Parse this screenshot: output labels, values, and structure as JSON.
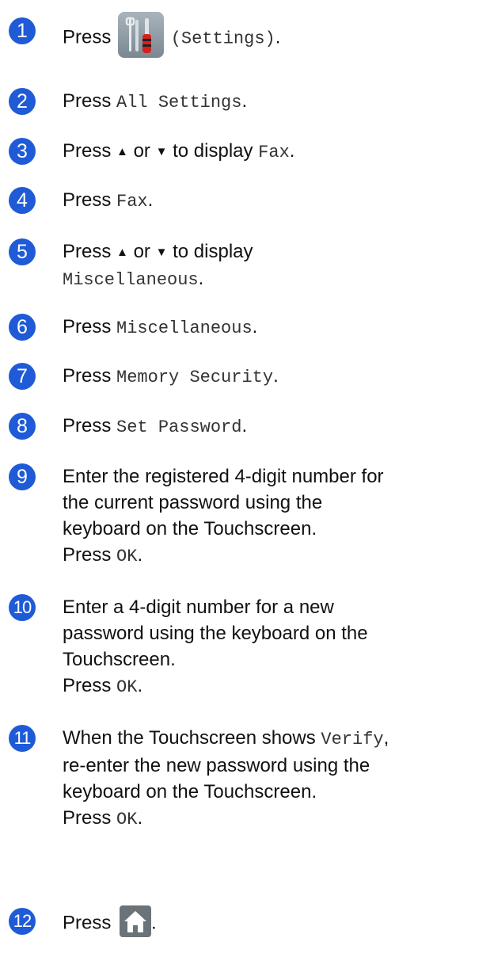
{
  "steps": [
    {
      "n": "1",
      "press": "Press",
      "mono": "(Settings)",
      "tail": "."
    },
    {
      "n": "2",
      "press": "Press",
      "mono": "All Settings",
      "tail": "."
    },
    {
      "n": "3",
      "press": "Press",
      "up": "▲",
      "or": "or",
      "down": "▼",
      "mid": "to display",
      "mono": "Fax",
      "tail": "."
    },
    {
      "n": "4",
      "press": "Press",
      "mono": "Fax",
      "tail": "."
    },
    {
      "n": "5",
      "press": "Press",
      "up": "▲",
      "or": "or",
      "down": "▼",
      "mid": "to display",
      "mono": "Miscellaneous",
      "tail": "."
    },
    {
      "n": "6",
      "press": "Press",
      "mono": "Miscellaneous",
      "tail": "."
    },
    {
      "n": "7",
      "press": "Press",
      "mono": "Memory Security",
      "tail": "."
    },
    {
      "n": "8",
      "press": "Press",
      "mono": "Set Password",
      "tail": "."
    },
    {
      "n": "9",
      "lines": [
        "Enter the registered 4-digit number for",
        "the current password using the",
        "keyboard on the Touchscreen."
      ],
      "press": "Press",
      "mono": "OK",
      "tail": "."
    },
    {
      "n": "10",
      "lines": [
        "Enter a 4-digit number for a new",
        "password using the keyboard on the",
        "Touchscreen."
      ],
      "press": "Press",
      "mono": "OK",
      "tail": "."
    },
    {
      "n": "11",
      "pre": "When the Touchscreen shows",
      "mono1": "Verify",
      "pre_tail": ",",
      "lines": [
        "re-enter the new password using the",
        "keyboard on the Touchscreen."
      ],
      "press": "Press",
      "mono": "OK",
      "tail": "."
    },
    {
      "n": "12",
      "press": "Press",
      "tail": "."
    }
  ],
  "colors": {
    "step_badge": "#1f5bd6",
    "text": "#111111",
    "mono_text": "#333333"
  },
  "icons": {
    "step1": "settings-icon",
    "step12": "home-icon"
  }
}
